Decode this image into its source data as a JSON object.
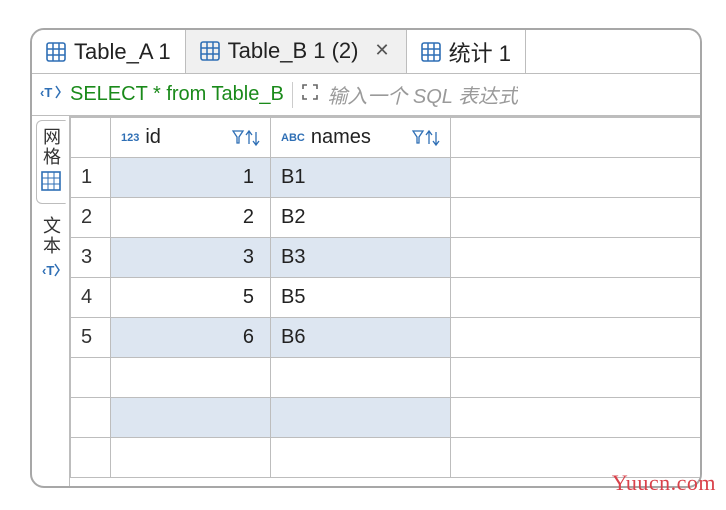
{
  "tabs": [
    {
      "label": "Table_A 1",
      "active": false,
      "closeable": false
    },
    {
      "label": "Table_B 1 (2)",
      "active": true,
      "closeable": true
    },
    {
      "label": "统计 1",
      "active": false,
      "closeable": false
    }
  ],
  "sql": {
    "query": "SELECT * from Table_B",
    "placeholder": "输入一个 SQL 表达式"
  },
  "sidetabs": {
    "grid": "网格",
    "text": "文本"
  },
  "columns": {
    "id": {
      "label": "id",
      "type": "123"
    },
    "names": {
      "label": "names",
      "type": "ABC"
    }
  },
  "rows": [
    {
      "n": "1",
      "id": "1",
      "names": "B1"
    },
    {
      "n": "2",
      "id": "2",
      "names": "B2"
    },
    {
      "n": "3",
      "id": "3",
      "names": "B3"
    },
    {
      "n": "4",
      "id": "5",
      "names": "B5"
    },
    {
      "n": "5",
      "id": "6",
      "names": "B6"
    }
  ],
  "watermark": "Yuucn.com",
  "colors": {
    "accent": "#2f6fb5",
    "sql_green": "#1a8a1a"
  }
}
